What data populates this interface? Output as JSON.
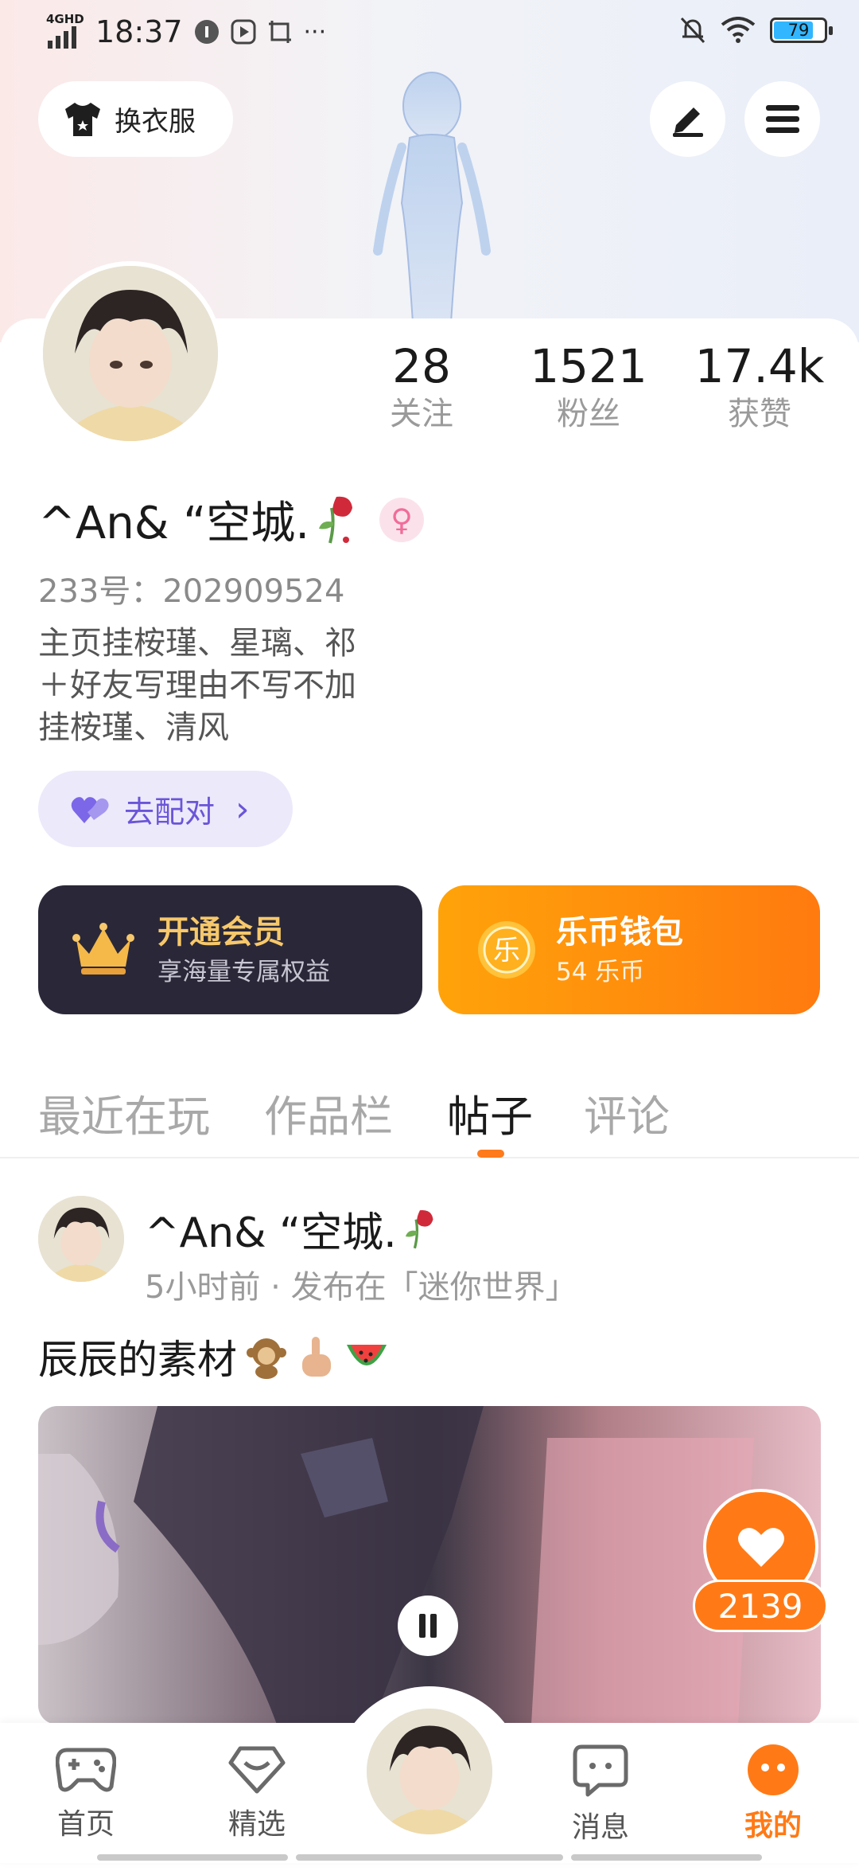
{
  "status_bar": {
    "network": "4GHD",
    "time": "18:37",
    "dots": "···",
    "battery": "79",
    "battery_level": 0.79
  },
  "header": {
    "dress_label": "换衣服"
  },
  "profile": {
    "stats": [
      {
        "value": "28",
        "label": "关注"
      },
      {
        "value": "1521",
        "label": "粉丝"
      },
      {
        "value": "17.4k",
        "label": "获赞"
      }
    ],
    "username": "^An& “空城.",
    "gender_symbol": "♀",
    "uid": "233号：202909524",
    "bio": [
      "主页挂桉瑾、星璃、祁",
      "＋好友写理由不写不加",
      "挂桉瑾、清风"
    ],
    "match_label": "去配对",
    "match_arrow": "›"
  },
  "cards": {
    "vip": {
      "title": "开通会员",
      "subtitle": "享海量专属权益"
    },
    "coin": {
      "title": "乐币钱包",
      "subtitle": "54 乐币",
      "coin_char": "乐"
    }
  },
  "tabs": [
    {
      "label": "最近在玩",
      "active": false
    },
    {
      "label": "作品栏",
      "active": false
    },
    {
      "label": "帖子",
      "active": true
    },
    {
      "label": "评论",
      "active": false
    }
  ],
  "post": {
    "author": "^An& “空城.",
    "meta": "5小时前 · 发布在「迷你世界」",
    "text": "辰辰的素材",
    "likes": "2139"
  },
  "bottom_nav": [
    {
      "label": "首页",
      "icon": "gamepad-icon",
      "active": false
    },
    {
      "label": "精选",
      "icon": "heart-diamond-icon",
      "active": false
    },
    {
      "label": "消息",
      "icon": "chat-icon",
      "active": false
    },
    {
      "label": "我的",
      "icon": "profile-icon",
      "active": true
    }
  ],
  "colors": {
    "accent": "#ff7a16",
    "vip_bg": "#2a2838",
    "vip_gold": "#f7c86b",
    "match_purple": "#6a55d8"
  }
}
